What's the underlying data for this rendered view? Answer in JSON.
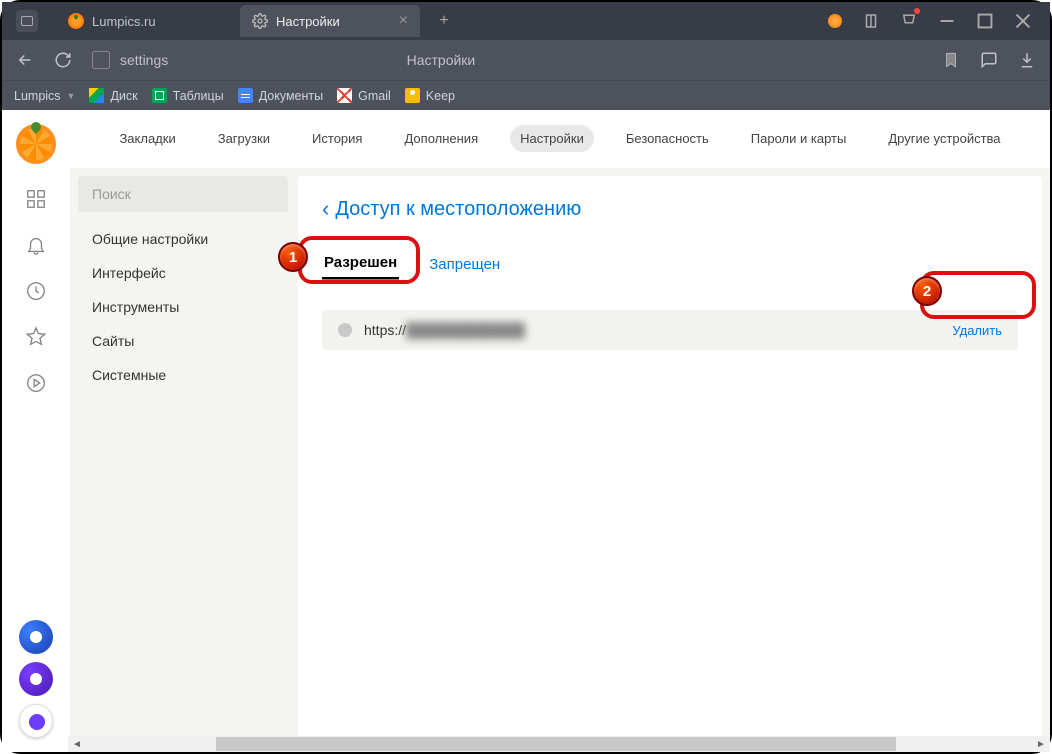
{
  "tabs": [
    {
      "label": "Lumpics.ru",
      "icon": "orange"
    },
    {
      "label": "Настройки",
      "icon": "gear",
      "active": true
    }
  ],
  "toolbar": {
    "address": "settings",
    "page_descriptor": "Настройки"
  },
  "bookmarks_bar": {
    "folder": "Lumpics",
    "items": [
      {
        "label": "Диск",
        "icon": "drive"
      },
      {
        "label": "Таблицы",
        "icon": "sheets"
      },
      {
        "label": "Документы",
        "icon": "docs"
      },
      {
        "label": "Gmail",
        "icon": "gmail"
      },
      {
        "label": "Keep",
        "icon": "keep"
      }
    ]
  },
  "topnav": [
    "Закладки",
    "Загрузки",
    "История",
    "Дополнения",
    "Настройки",
    "Безопасность",
    "Пароли и карты",
    "Другие устройства"
  ],
  "topnav_active": 4,
  "leftnav": {
    "search_placeholder": "Поиск",
    "items": [
      "Общие настройки",
      "Интерфейс",
      "Инструменты",
      "Сайты",
      "Системные"
    ]
  },
  "page": {
    "title": "Доступ к местоположению",
    "tabs": {
      "allowed": "Разрешен",
      "denied": "Запрещен"
    },
    "site": {
      "prefix": "https://",
      "blurred": "████████████",
      "delete_label": "Удалить"
    }
  },
  "annotations": {
    "one": "1",
    "two": "2"
  }
}
